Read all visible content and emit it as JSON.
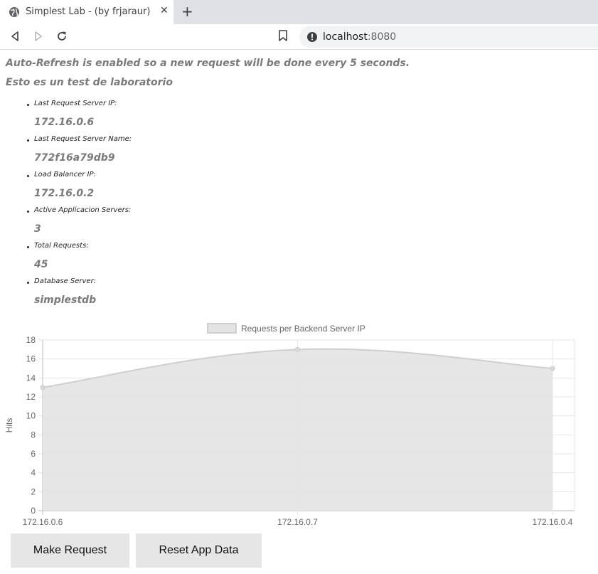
{
  "browser": {
    "tab_title": "Simplest Lab - (by frjaraur)",
    "url_host": "localhost",
    "url_port": ":8080"
  },
  "page": {
    "autorefresh_text": "Auto-Refresh is enabled so a new request will be done every 5 seconds.",
    "subtitle": "Esto es un test de laboratorio",
    "info_items": [
      {
        "label": "Last Request Server IP:",
        "value": "172.16.0.6"
      },
      {
        "label": "Last Request Server Name:",
        "value": "772f16a79db9"
      },
      {
        "label": "Load Balancer IP:",
        "value": "172.16.0.2"
      },
      {
        "label": "Active Applicacion Servers:",
        "value": "3"
      },
      {
        "label": "Total Requests:",
        "value": "45"
      },
      {
        "label": "Database Server:",
        "value": "simplestdb"
      }
    ],
    "buttons": {
      "make_request": "Make Request",
      "reset": "Reset App Data"
    }
  },
  "chart_data": {
    "type": "area",
    "categories": [
      "172.16.0.6",
      "172.16.0.7",
      "172.16.0.4"
    ],
    "series": [
      {
        "name": "Requests per Backend Server IP",
        "values": [
          13,
          17,
          15
        ]
      }
    ],
    "ylabel": "Hits",
    "ylim": [
      0,
      18
    ],
    "yticks": [
      0,
      2,
      4,
      6,
      8,
      10,
      12,
      14,
      16,
      18
    ],
    "grid": true,
    "legend_position": "top",
    "colors": {
      "fill": "#e3e3e3",
      "line": "#cfcfcf",
      "point": "#cccccc"
    }
  }
}
